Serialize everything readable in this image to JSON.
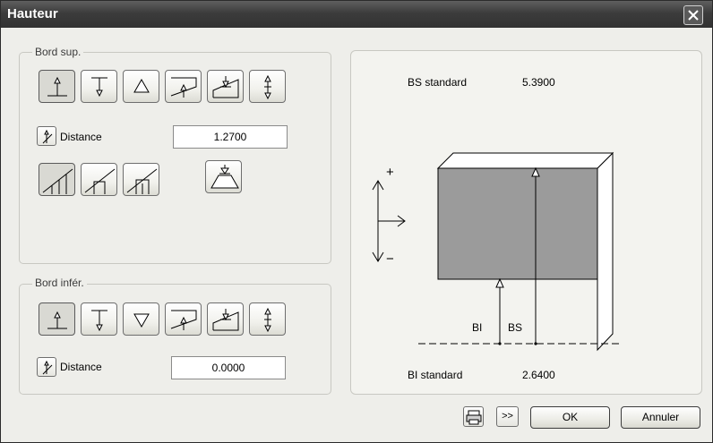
{
  "window": {
    "title": "Hauteur"
  },
  "bord_sup": {
    "legend": "Bord sup.",
    "distance_label": "Distance",
    "distance_value": "1.2700"
  },
  "bord_inf": {
    "legend": "Bord infér.",
    "distance_label": "Distance",
    "distance_value": "0.0000"
  },
  "preview": {
    "bs_label": "BS standard",
    "bs_value": "5.3900",
    "bi_label": "BI standard",
    "bi_value": "2.6400",
    "plus": "+",
    "minus": "−",
    "bi_short": "BI",
    "bs_short": "BS"
  },
  "buttons": {
    "ok": "OK",
    "cancel": "Annuler",
    "more": ">>"
  },
  "icons": {
    "close": "close-icon",
    "print": "printer-icon"
  }
}
